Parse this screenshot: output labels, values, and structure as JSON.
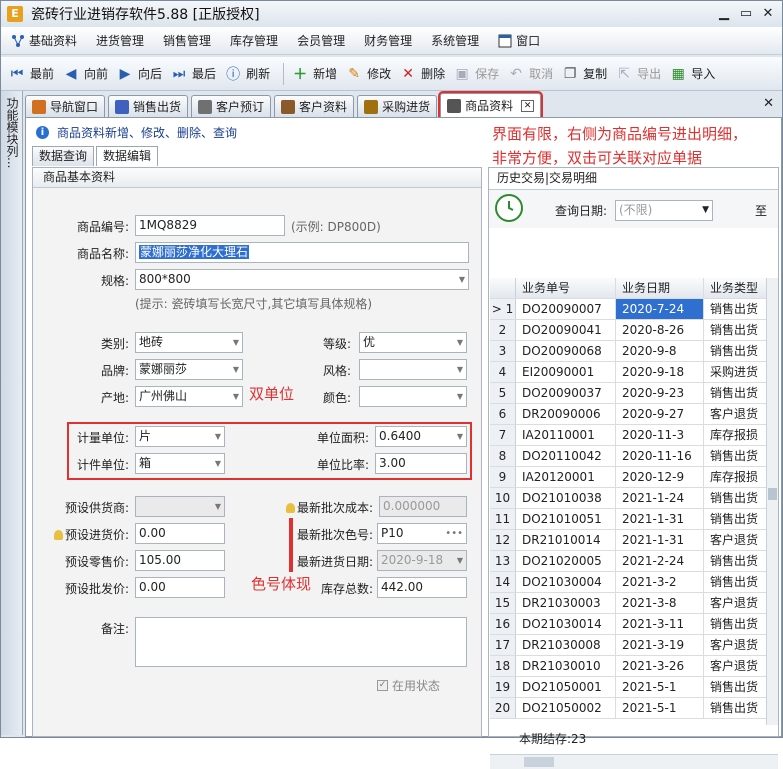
{
  "window": {
    "title": "瓷砖行业进销存软件5.88 [正版授权]",
    "app_icon": "E"
  },
  "menu": [
    {
      "label": "基础资料",
      "icon": "network-icon"
    },
    {
      "label": "进货管理"
    },
    {
      "label": "销售管理"
    },
    {
      "label": "库存管理"
    },
    {
      "label": "会员管理"
    },
    {
      "label": "财务管理"
    },
    {
      "label": "系统管理"
    },
    {
      "label": "窗口",
      "icon": "window-icon"
    }
  ],
  "toolbar": {
    "first": "最前",
    "prev": "向前",
    "next": "向后",
    "last": "最后",
    "refresh": "刷新",
    "add": "新增",
    "edit": "修改",
    "delete": "删除",
    "save": "保存",
    "cancel": "取消",
    "copy": "复制",
    "export": "导出",
    "import": "导入"
  },
  "sidebar": {
    "label": "功能模块列..."
  },
  "tabs": [
    {
      "label": "导航窗口",
      "icon_color": "#d07020"
    },
    {
      "label": "销售出货",
      "icon_color": "#4060c0"
    },
    {
      "label": "客户预订",
      "icon_color": "#707070"
    },
    {
      "label": "客户资料",
      "icon_color": "#8a5a2a"
    },
    {
      "label": "采购进货",
      "icon_color": "#a07010"
    },
    {
      "label": "商品资料",
      "icon_color": "#555555"
    }
  ],
  "info_text": "商品资料新增、修改、删除、查询",
  "annotations": {
    "right_note_line1": "界面有限，右侧为商品编号进出明细，",
    "right_note_line2": "非常方便，双击可关联对应单据",
    "dual_unit": "双单位",
    "color_code": "色号体现"
  },
  "subtabs": {
    "query": "数据查询",
    "edit": "数据编辑"
  },
  "form": {
    "panel_title": "商品基本资料",
    "code_label": "商品编号:",
    "code_value": "1MQ8829",
    "code_example": "(示例: DP800D)",
    "name_label": "商品名称:",
    "name_value": "蒙娜丽莎净化大理石",
    "spec_label": "规格:",
    "spec_value": "800*800",
    "spec_hint": "(提示: 瓷砖填写长宽尺寸,其它填写具体规格)",
    "category_label": "类别:",
    "category_value": "地砖",
    "grade_label": "等级:",
    "grade_value": "优",
    "brand_label": "品牌:",
    "brand_value": "蒙娜丽莎",
    "style_label": "风格:",
    "style_value": "",
    "origin_label": "产地:",
    "origin_value": "广州佛山",
    "color_label": "颜色:",
    "color_value": "",
    "unit_label": "计量单位:",
    "unit_value": "片",
    "area_label": "单位面积:",
    "area_value": "0.6400",
    "piece_unit_label": "计件单位:",
    "piece_unit_value": "箱",
    "ratio_label": "单位比率:",
    "ratio_value": "3.00",
    "supplier_label": "预设供货商:",
    "supplier_value": "",
    "last_cost_label": "最新批次成本:",
    "last_cost_value": "0.000000",
    "purchase_price_label": "预设进货价:",
    "purchase_price_value": "0.00",
    "last_color_label": "最新批次色号:",
    "last_color_value": "P10",
    "retail_label": "预设零售价:",
    "retail_value": "105.00",
    "last_date_label": "最新进货日期:",
    "last_date_value": "2020-9-18",
    "wholesale_label": "预设批发价:",
    "wholesale_value": "0.00",
    "stock_label": "库存总数:",
    "stock_value": "442.00",
    "remark_label": "备注:",
    "active_label": "在用状态"
  },
  "history": {
    "title": "历史交易|交易明细",
    "query_date_label": "查询日期:",
    "query_date_value": "(不限)",
    "to_label": "至",
    "columns": [
      "业务单号",
      "业务日期",
      "业务类型"
    ],
    "rows": [
      {
        "no": "1",
        "code": "DO20090007",
        "date": "2020-7-24",
        "type": "销售出货"
      },
      {
        "no": "2",
        "code": "DO20090041",
        "date": "2020-8-26",
        "type": "销售出货"
      },
      {
        "no": "3",
        "code": "DO20090068",
        "date": "2020-9-8",
        "type": "销售出货"
      },
      {
        "no": "4",
        "code": "EI20090001",
        "date": "2020-9-18",
        "type": "采购进货"
      },
      {
        "no": "5",
        "code": "DO20090037",
        "date": "2020-9-23",
        "type": "销售出货"
      },
      {
        "no": "6",
        "code": "DR20090006",
        "date": "2020-9-27",
        "type": "客户退货"
      },
      {
        "no": "7",
        "code": "IA20110001",
        "date": "2020-11-3",
        "type": "库存报损"
      },
      {
        "no": "8",
        "code": "DO20110042",
        "date": "2020-11-16",
        "type": "销售出货"
      },
      {
        "no": "9",
        "code": "IA20120001",
        "date": "2020-12-9",
        "type": "库存报损"
      },
      {
        "no": "10",
        "code": "DO21010038",
        "date": "2021-1-24",
        "type": "销售出货"
      },
      {
        "no": "11",
        "code": "DO21010051",
        "date": "2021-1-31",
        "type": "销售出货"
      },
      {
        "no": "12",
        "code": "DR21010014",
        "date": "2021-1-31",
        "type": "客户退货"
      },
      {
        "no": "13",
        "code": "DO21020005",
        "date": "2021-2-24",
        "type": "销售出货"
      },
      {
        "no": "14",
        "code": "DO21030004",
        "date": "2021-3-2",
        "type": "销售出货"
      },
      {
        "no": "15",
        "code": "DR21030003",
        "date": "2021-3-8",
        "type": "客户退货"
      },
      {
        "no": "16",
        "code": "DO21030014",
        "date": "2021-3-11",
        "type": "销售出货"
      },
      {
        "no": "17",
        "code": "DR21030008",
        "date": "2021-3-19",
        "type": "客户退货"
      },
      {
        "no": "18",
        "code": "DR21030010",
        "date": "2021-3-26",
        "type": "客户退货"
      },
      {
        "no": "19",
        "code": "DO21050001",
        "date": "2021-5-1",
        "type": "销售出货"
      },
      {
        "no": "20",
        "code": "DO21050002",
        "date": "2021-5-1",
        "type": "销售出货"
      }
    ],
    "footer": "本期结存:23"
  }
}
